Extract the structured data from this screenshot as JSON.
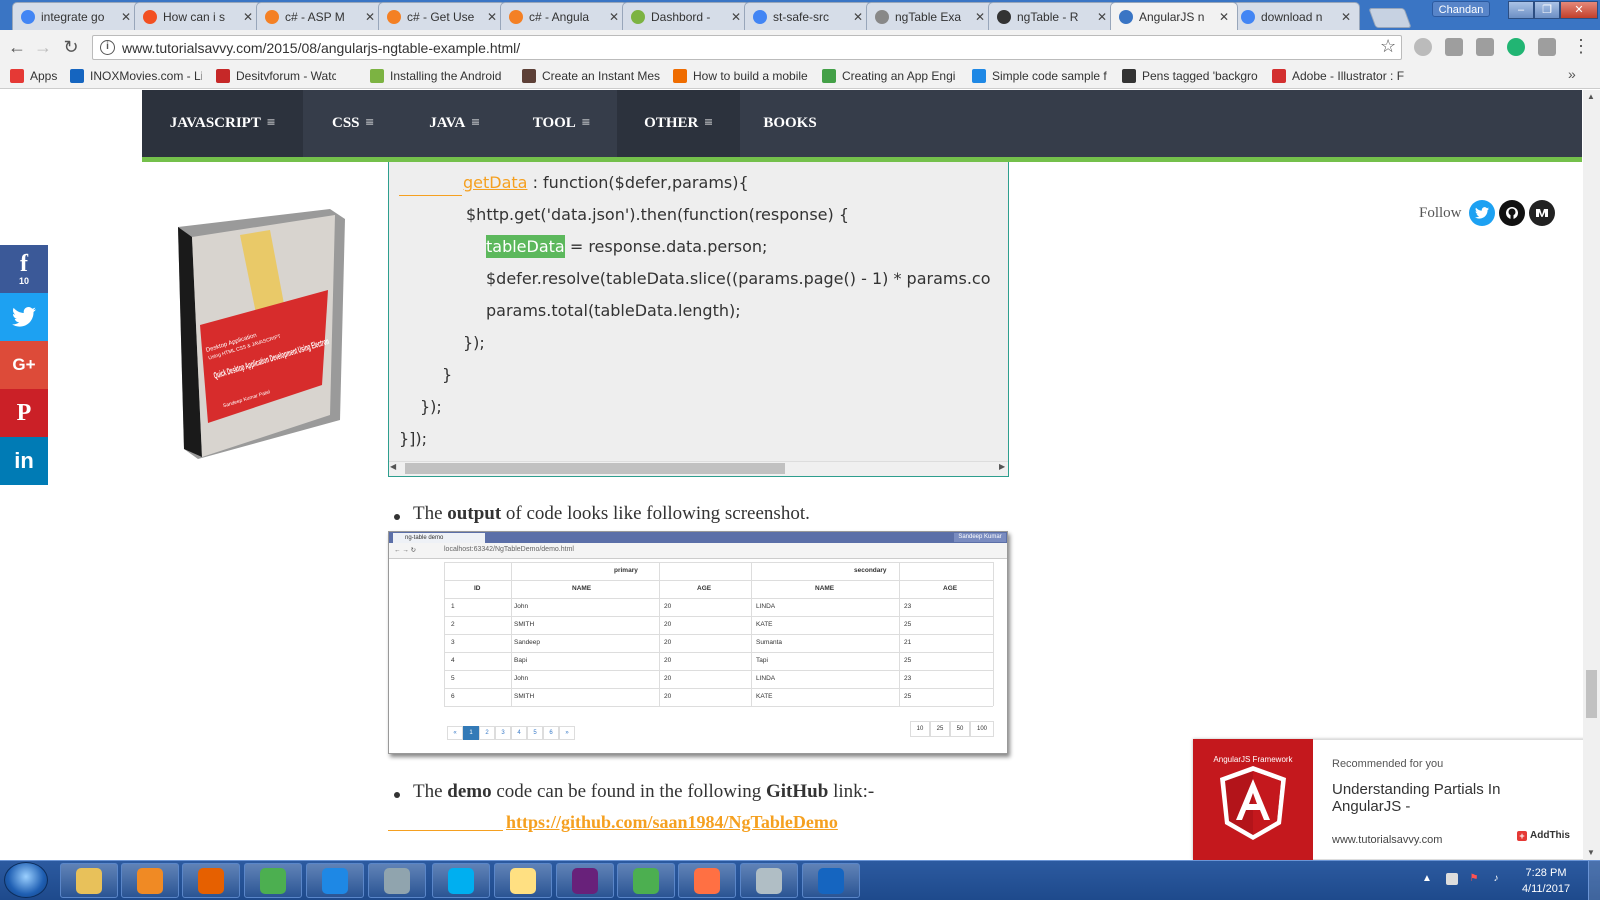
{
  "browser": {
    "tabs": [
      {
        "title": "integrate go",
        "icon": "google-icon",
        "color": "#4285f4"
      },
      {
        "title": "How can i s",
        "icon": "microsoft-icon",
        "color": "#f25022"
      },
      {
        "title": "c# - ASP M",
        "icon": "stackoverflow-icon",
        "color": "#f48024"
      },
      {
        "title": "c# - Get Use",
        "icon": "stackoverflow-icon",
        "color": "#f48024"
      },
      {
        "title": "c# - Angula",
        "icon": "stackoverflow-icon",
        "color": "#f48024"
      },
      {
        "title": "Dashbord -",
        "icon": "dashboard-icon",
        "color": "#7cb342"
      },
      {
        "title": "st-safe-src",
        "icon": "google-icon",
        "color": "#4285f4"
      },
      {
        "title": "ngTable Exa",
        "icon": "page-icon",
        "color": "#888888"
      },
      {
        "title": "ngTable - R",
        "icon": "codepen-icon",
        "color": "#333333"
      },
      {
        "title": "AngularJS n",
        "icon": "tutorialsavvy-icon",
        "color": "#3a75c4"
      },
      {
        "title": "download n",
        "icon": "google-icon",
        "color": "#4285f4"
      }
    ],
    "user_badge": "Chandan",
    "window_buttons": {
      "minimize": "–",
      "maximize": "❐",
      "close": "✕"
    },
    "url": "www.tutorialsavvy.com/2015/08/angularjs-ngtable-example.html/",
    "bookmarks": [
      {
        "label": "Apps",
        "color": "#e53935"
      },
      {
        "label": "INOXMovies.com - Liv",
        "color": "#1565c0"
      },
      {
        "label": "Desitvforum - Watch",
        "color": "#c62828"
      },
      {
        "label": "Installing the Android",
        "color": "#7cb342"
      },
      {
        "label": "Create an Instant Mes",
        "color": "#5d4037"
      },
      {
        "label": "How to build a mobile",
        "color": "#ef6c00"
      },
      {
        "label": "Creating an App Engi",
        "color": "#43a047"
      },
      {
        "label": "Simple code sample f",
        "color": "#1e88e5"
      },
      {
        "label": "Pens tagged 'backgro",
        "color": "#333333"
      },
      {
        "label": "Adobe - Illustrator : F",
        "color": "#d32f2f"
      }
    ],
    "bookmarks_overflow": "»"
  },
  "site_nav": {
    "items": [
      "JAVASCRIPT",
      "CSS",
      "JAVA",
      "TOOL",
      "OTHER",
      "BOOKS"
    ],
    "menu_glyph": "≡"
  },
  "social": {
    "facebook": {
      "glyph": "f",
      "count": "10",
      "color": "#3b5998"
    },
    "twitter": {
      "color": "#1da1f2"
    },
    "googleplus": {
      "glyph": "G+",
      "color": "#dd4b39"
    },
    "pinterest": {
      "glyph": "P",
      "color": "#cb2027"
    },
    "linkedin": {
      "glyph": "in",
      "color": "#007bb5"
    }
  },
  "book": {
    "line1": "Desktop Application",
    "line2": "Using HTML CSS & JAVASCRIPT",
    "title": "Quick Desktop Application Development Using Electron",
    "author": "Sandeep Kumar Patel"
  },
  "code": {
    "l1_key": "getData",
    "l1_rest": " : function($defer,params){",
    "l2": "$http.get('data.json').then(function(response) {",
    "l3_key": "tableData",
    "l3_rest": " = response.data.person;",
    "l4": "$defer.resolve(tableData.slice((params.page() - 1) * params.co",
    "l5": "params.total(tableData.length);",
    "l6": "});",
    "l7": "}",
    "l8": "});",
    "l9": "}]);"
  },
  "article": {
    "p1_pre": "The ",
    "p1_bold": "output",
    "p1_post": " of code looks like following screenshot.",
    "p2_pre": "The ",
    "p2_bold": "demo",
    "p2_mid": " code can be found in the following ",
    "p2_bold2": "GitHub",
    "p2_post": " link:-",
    "github_link": "https://github.com/saan1984/NgTableDemo"
  },
  "screenshot": {
    "tab_title": "ng-table demo",
    "user": "Sandeep Kumar",
    "url": "localhost:63342/NgTableDemo/demo.html",
    "group_primary": "primary",
    "group_secondary": "secondary",
    "headers": [
      "ID",
      "NAME",
      "AGE",
      "NAME",
      "AGE"
    ],
    "rows": [
      [
        "1",
        "John",
        "20",
        "LINDA",
        "23"
      ],
      [
        "2",
        "SMITH",
        "20",
        "KATE",
        "25"
      ],
      [
        "3",
        "Sandeep",
        "20",
        "Sumanta",
        "21"
      ],
      [
        "4",
        "Bapi",
        "20",
        "Tapi",
        "25"
      ],
      [
        "5",
        "John",
        "20",
        "LINDA",
        "23"
      ],
      [
        "6",
        "SMITH",
        "20",
        "KATE",
        "25"
      ]
    ],
    "pages": [
      "«",
      "1",
      "2",
      "3",
      "4",
      "5",
      "6",
      "»"
    ],
    "page_sizes": [
      "10",
      "25",
      "50",
      "100"
    ]
  },
  "follow": {
    "label": "Follow"
  },
  "recommended": {
    "image_caption": "AngularJS Framework",
    "label": "Recommended for you",
    "title": "Understanding Partials In AngularJS -",
    "site": "www.tutorialsavvy.com",
    "addthis": "AddThis"
  },
  "taskbar": {
    "time": "7:28 PM",
    "date": "4/11/2017",
    "apps": [
      {
        "name": "explorer",
        "color": "#e8c15a"
      },
      {
        "name": "media-player",
        "color": "#f08a24"
      },
      {
        "name": "firefox",
        "color": "#e66000"
      },
      {
        "name": "chrome",
        "color": "#4caf50"
      },
      {
        "name": "internet-explorer",
        "color": "#1e88e5"
      },
      {
        "name": "network",
        "color": "#90a4ae"
      },
      {
        "name": "skype",
        "color": "#00aff0"
      },
      {
        "name": "sticky-notes",
        "color": "#ffe082"
      },
      {
        "name": "visual-studio",
        "color": "#68217a"
      },
      {
        "name": "chrome-2",
        "color": "#4caf50"
      },
      {
        "name": "snipping-tool",
        "color": "#ff7043"
      },
      {
        "name": "notepad",
        "color": "#b0bec5"
      },
      {
        "name": "powershell",
        "color": "#1565c0"
      }
    ]
  }
}
